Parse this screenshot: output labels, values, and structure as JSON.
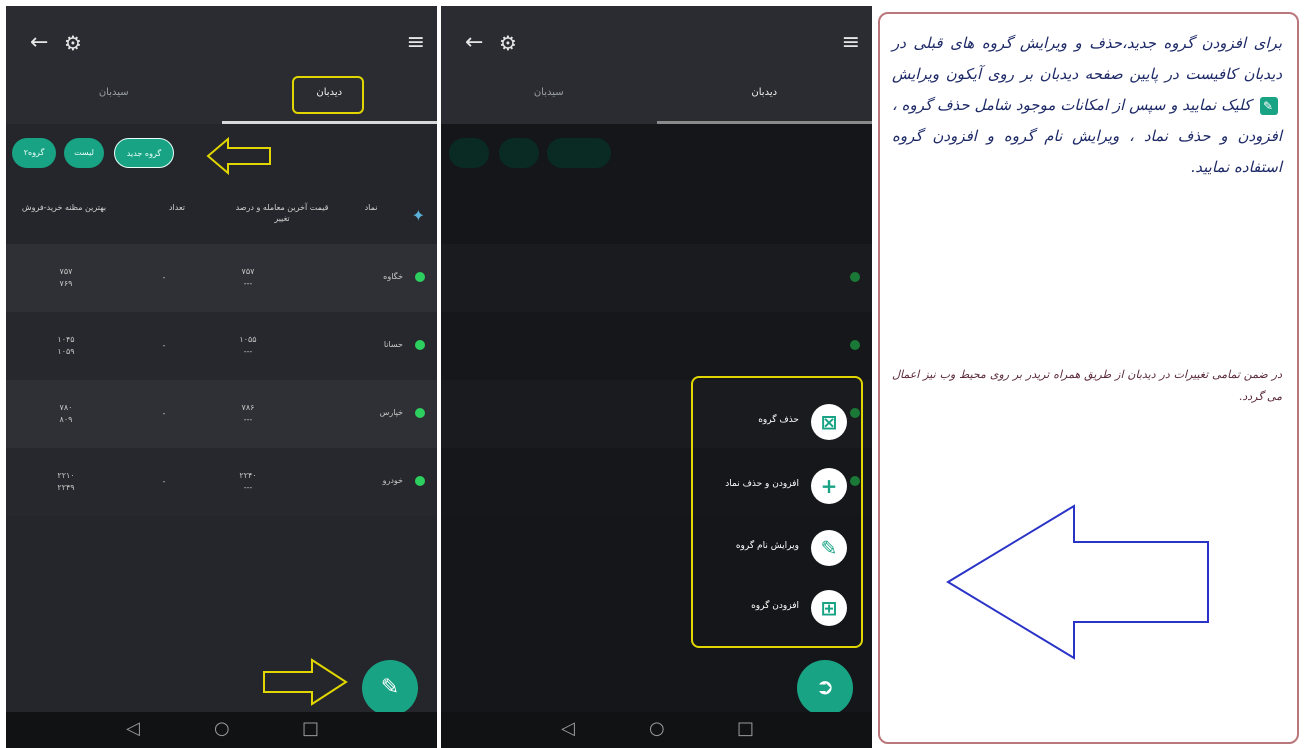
{
  "colors": {
    "accent": "#19a385",
    "highlight": "#e1d600",
    "arrow_blue": "#2a33c8",
    "frame": "#b9777b"
  },
  "phone1": {
    "tabs": {
      "active": "دیدبان",
      "inactive": "سیدبان"
    },
    "chips": [
      "گروه جدید",
      "لیست",
      "گروه۲"
    ],
    "headers": {
      "symbol": "نماد",
      "last_price": "قیمت آخرین معامله و درصد تغییر",
      "volume": "تعداد",
      "best": "بهترین مظنه خرید-فروش"
    },
    "rows": [
      {
        "symbol": "خگاوه",
        "last": "۷۵۷",
        "change": "---",
        "vol": "-",
        "best1": "۷۵۷",
        "best2": "۷۶۹"
      },
      {
        "symbol": "حسانا",
        "last": "۱۰۵۵",
        "change": "---",
        "vol": "-",
        "best1": "۱۰۴۵",
        "best2": "۱۰۵۹"
      },
      {
        "symbol": "خپارس",
        "last": "۷۸۶",
        "change": "---",
        "vol": "-",
        "best1": "۷۸۰",
        "best2": "۸۰۹"
      },
      {
        "symbol": "خودرو",
        "last": "۲۲۴۰",
        "change": "---",
        "vol": "-",
        "best1": "۲۲۱۰",
        "best2": "۲۲۴۹"
      }
    ]
  },
  "phone2": {
    "tabs": {
      "active": "دیدبان",
      "inactive": "سیدبان"
    },
    "menu": [
      {
        "label": "حذف گروه",
        "icon": "grid-remove-icon"
      },
      {
        "label": "افزودن و حذف نماد",
        "icon": "plus-icon"
      },
      {
        "label": "ویرایش نام گروه",
        "icon": "edit-icon"
      },
      {
        "label": "افزودن گروه",
        "icon": "grid-add-icon"
      }
    ]
  },
  "info": {
    "main_before": "برای افزودن گروه جدید،حذف و ویرایش گروه های قبلی در دیدبان کافیست در پایین صفحه دیدبان بر روی آیکون ویرایش",
    "main_after": "کلیک نمایید و سپس از امکانات موجود شامل حذف گروه ، افزودن و حذف نماد ، ویرایش نام گروه و افزودن گروه استفاده نمایید.",
    "note": "در ضمن تمامی تغییرات در دیدبان از طریق همراه تریدر بر روی محیط وب نیز اعمال می گردد."
  }
}
